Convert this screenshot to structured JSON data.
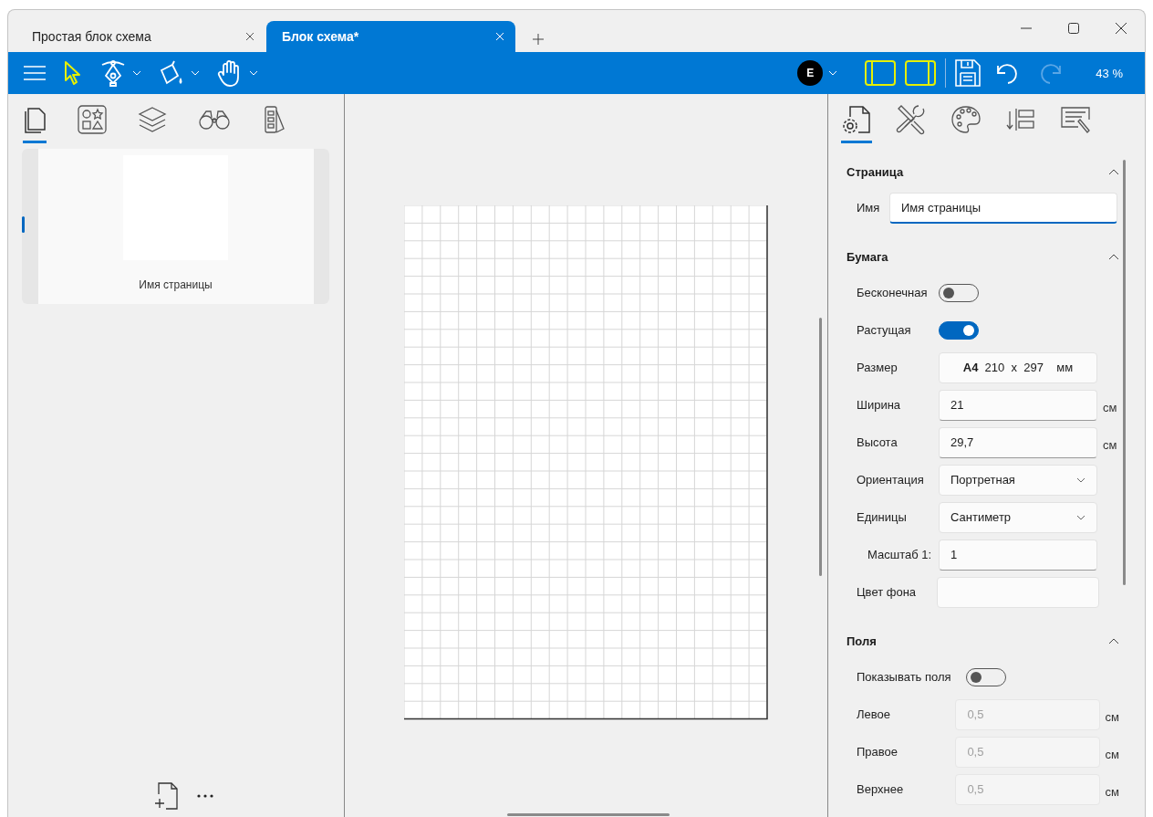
{
  "tabs": [
    {
      "label": "Простая блок схема",
      "selected": false
    },
    {
      "label": "Блок схема*",
      "selected": true
    }
  ],
  "toolbar": {
    "tools": [
      {
        "kind": "pointer",
        "selected": true,
        "menu": false
      },
      {
        "kind": "pen",
        "selected": false,
        "menu": true
      },
      {
        "kind": "fill",
        "selected": false,
        "menu": true
      },
      {
        "kind": "hand",
        "selected": false,
        "menu": true
      }
    ],
    "user_initial": "E",
    "left_panel_on": true,
    "right_panel_on": true,
    "redo_disabled": true,
    "zoom": "43 %"
  },
  "left_panel": {
    "tabs": [
      {
        "kind": "pages",
        "selected": true
      },
      {
        "kind": "shapes",
        "selected": false
      },
      {
        "kind": "layers",
        "selected": false
      },
      {
        "kind": "find",
        "selected": false
      },
      {
        "kind": "swatches",
        "selected": false
      }
    ],
    "pages": [
      {
        "name": "Имя страницы",
        "selected": true
      }
    ]
  },
  "right_panel": {
    "tabs": [
      {
        "kind": "page-settings",
        "selected": true
      },
      {
        "kind": "tools",
        "selected": false
      },
      {
        "kind": "palette",
        "selected": false
      },
      {
        "kind": "arrange",
        "selected": false
      },
      {
        "kind": "annotate",
        "selected": false
      }
    ],
    "sections": [
      {
        "title": "Страница",
        "expanded": true,
        "rows": [
          {
            "kind": "text",
            "label": "Имя",
            "value": "Имя страницы",
            "focused": true
          }
        ]
      },
      {
        "title": "Бумага",
        "expanded": true,
        "rows": [
          {
            "kind": "toggle",
            "label": "Бесконечная",
            "on": false
          },
          {
            "kind": "toggle",
            "label": "Растущая",
            "on": true
          },
          {
            "kind": "size",
            "label": "Размер",
            "value": "**A4**  210  x  297    мм"
          },
          {
            "kind": "input",
            "label": "Ширина",
            "value": "21",
            "unit": "см",
            "disabled": false
          },
          {
            "kind": "input",
            "label": "Высота",
            "value": "29,7",
            "unit": "см",
            "disabled": false
          },
          {
            "kind": "select",
            "label": "Ориентация",
            "value": "Портретная"
          },
          {
            "kind": "select",
            "label": "Единицы",
            "value": "Сантиметр"
          },
          {
            "kind": "scale",
            "label": "Масштаб 1:",
            "value": "1"
          },
          {
            "kind": "color",
            "label": "Цвет фона"
          }
        ]
      },
      {
        "title": "Поля",
        "expanded": true,
        "rows": [
          {
            "kind": "toggle",
            "label": "Показывать поля",
            "on": false
          },
          {
            "kind": "input",
            "label": "Левое",
            "value": "0,5",
            "unit": "см",
            "disabled": true
          },
          {
            "kind": "input",
            "label": "Правое",
            "value": "0,5",
            "unit": "см",
            "disabled": true
          },
          {
            "kind": "input",
            "label": "Верхнее",
            "value": "0,5",
            "unit": "см",
            "disabled": true
          }
        ]
      }
    ]
  }
}
